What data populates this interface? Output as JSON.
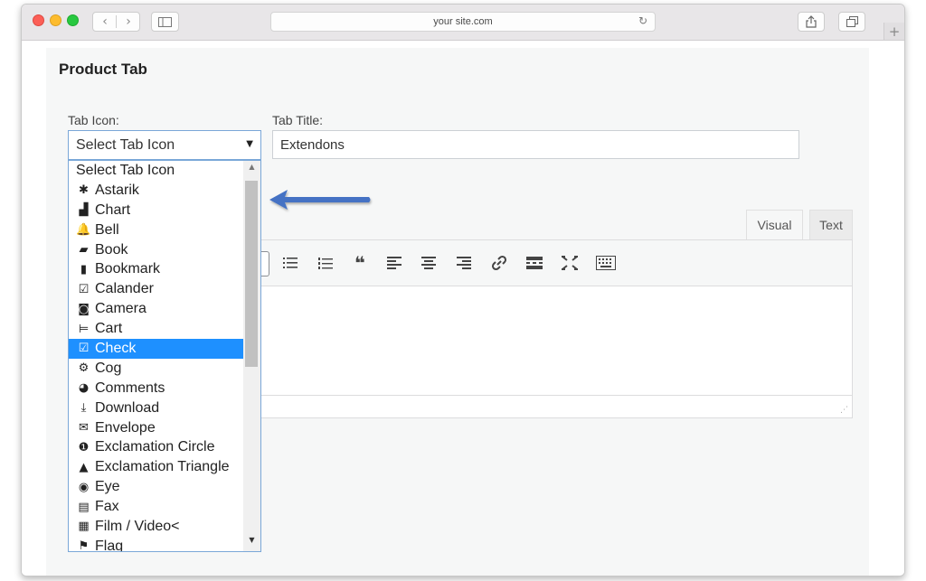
{
  "browser": {
    "url": "your site.com"
  },
  "page": {
    "title": "Product Tab",
    "tab_icon_label": "Tab Icon:",
    "tab_title_label": "Tab Title:",
    "select_value": "Select Tab Icon",
    "tab_title_value": "Extendons"
  },
  "editor": {
    "tabs": {
      "visual": "Visual",
      "text": "Text"
    },
    "toolbar_icons": [
      "bullet-list-icon",
      "numbered-list-icon",
      "blockquote-icon",
      "align-left-icon",
      "align-center-icon",
      "align-right-icon",
      "link-icon",
      "read-more-icon",
      "fullscreen-icon",
      "toolbar-toggle-icon"
    ]
  },
  "dropdown": {
    "selected_index": 9,
    "options": [
      {
        "label": "Select Tab Icon",
        "icon": ""
      },
      {
        "label": "Astarik",
        "icon": "✱"
      },
      {
        "label": "Chart",
        "icon": "▟"
      },
      {
        "label": "Bell",
        "icon": "🔔"
      },
      {
        "label": "Book",
        "icon": "▰"
      },
      {
        "label": "Bookmark",
        "icon": "▮"
      },
      {
        "label": "Calander",
        "icon": "☑"
      },
      {
        "label": "Camera",
        "icon": "◙"
      },
      {
        "label": "Cart",
        "icon": "⊨"
      },
      {
        "label": "Check",
        "icon": "☑"
      },
      {
        "label": "Cog",
        "icon": "⚙"
      },
      {
        "label": "Comments",
        "icon": "◕"
      },
      {
        "label": "Download",
        "icon": "⤓"
      },
      {
        "label": "Envelope",
        "icon": "✉"
      },
      {
        "label": "Exclamation Circle",
        "icon": "❶"
      },
      {
        "label": "Exclamation Triangle",
        "icon": "▲"
      },
      {
        "label": "Eye",
        "icon": "◉"
      },
      {
        "label": "Fax",
        "icon": "▤"
      },
      {
        "label": "Film / Video<",
        "icon": "▦"
      },
      {
        "label": "Flag",
        "icon": "⚑"
      }
    ]
  },
  "colors": {
    "accent": "#1e90ff",
    "arrow": "#4472c4"
  }
}
